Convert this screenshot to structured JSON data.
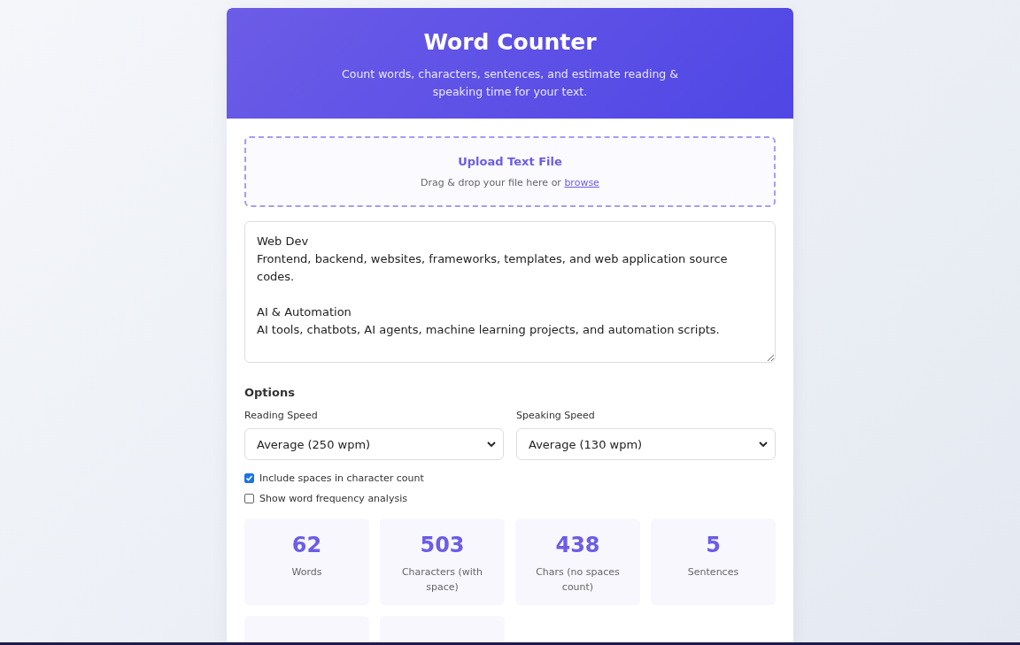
{
  "header": {
    "title": "Word Counter",
    "subtitle": "Count words, characters, sentences, and estimate reading & speaking time for your text."
  },
  "upload": {
    "title": "Upload Text File",
    "hint": "Drag & drop your file here or ",
    "link": "browse"
  },
  "text_input": {
    "paragraphs": [
      [
        "Web Dev",
        "Frontend, backend, websites, frameworks, templates, and web application source codes."
      ],
      [
        "AI & Automation",
        "AI tools, chatbots, AI agents, machine learning projects, and automation scripts."
      ]
    ]
  },
  "options": {
    "title": "Options",
    "selects": [
      {
        "label": "Reading Speed",
        "value": "Average (250 wpm)"
      },
      {
        "label": "Speaking Speed",
        "value": "Average (130 wpm)"
      }
    ],
    "checkboxes": [
      {
        "label": "Include spaces in character count",
        "checked": true
      },
      {
        "label": "Show word frequency analysis",
        "checked": false
      }
    ]
  },
  "stats": [
    {
      "value": "62",
      "label": "Words"
    },
    {
      "value": "503",
      "label": "Characters (with space)"
    },
    {
      "value": "438",
      "label": "Chars (no spaces count)"
    },
    {
      "value": "5",
      "label": "Sentences"
    }
  ]
}
